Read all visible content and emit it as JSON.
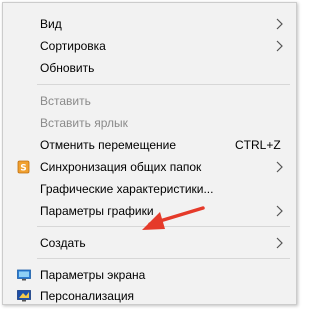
{
  "menu": {
    "items": [
      {
        "label": "Вид",
        "submenu": true,
        "icon": null
      },
      {
        "label": "Сортировка",
        "submenu": true,
        "icon": null
      },
      {
        "label": "Обновить",
        "submenu": false,
        "icon": null
      },
      {
        "label": "Вставить",
        "disabled": true
      },
      {
        "label": "Вставить ярлык",
        "disabled": true
      },
      {
        "label": "Отменить перемещение",
        "shortcut": "CTRL+Z"
      },
      {
        "label": "Синхронизация общих папок",
        "submenu": true,
        "icon": "sync-folders-icon"
      },
      {
        "label": "Графические характеристики..."
      },
      {
        "label": "Параметры графики",
        "submenu": true
      },
      {
        "label": "Создать",
        "submenu": true
      },
      {
        "label": "Параметры экрана",
        "icon": "display-settings-icon"
      },
      {
        "label": "Персонализация",
        "icon": "personalization-icon"
      }
    ]
  },
  "colors": {
    "background": "#f2f2f2",
    "disabled_text": "#8a8a8a",
    "separator": "#d7d7d7",
    "annotation_arrow": "#e53a2a"
  }
}
